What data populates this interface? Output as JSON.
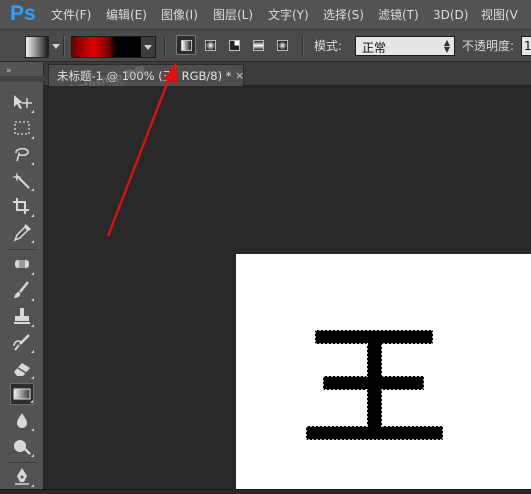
{
  "app": {
    "logo_text": "Ps",
    "brand_color": "#2fa0ff"
  },
  "menu": {
    "items": [
      {
        "label": "文件(F)"
      },
      {
        "label": "编辑(E)"
      },
      {
        "label": "图像(I)"
      },
      {
        "label": "图层(L)"
      },
      {
        "label": "文字(Y)"
      },
      {
        "label": "选择(S)"
      },
      {
        "label": "滤镜(T)"
      },
      {
        "label": "3D(D)"
      },
      {
        "label": "视图(V"
      }
    ]
  },
  "options_bar": {
    "gradient_colors": [
      "#6a0000",
      "#e00000",
      "#000000"
    ],
    "gradient_types": [
      "linear",
      "radial",
      "angle",
      "reflected",
      "diamond"
    ],
    "active_gradient_type": "linear",
    "mode_label": "模式:",
    "mode_value": "正常",
    "opacity_label": "不透明度:",
    "opacity_value": "1"
  },
  "toolbox": {
    "tools": [
      {
        "name": "move-tool",
        "glyph": "▸✥"
      },
      {
        "name": "marquee-tool",
        "glyph": "⬚"
      },
      {
        "name": "lasso-tool",
        "glyph": "ℓ"
      },
      {
        "name": "magic-wand-tool",
        "glyph": "✵"
      },
      {
        "name": "crop-tool",
        "glyph": "⊞"
      },
      {
        "name": "eyedropper-tool",
        "glyph": "✎"
      },
      {
        "name": "healing-brush-tool",
        "glyph": "✺"
      },
      {
        "name": "brush-tool",
        "glyph": "✒"
      },
      {
        "name": "clone-stamp-tool",
        "glyph": "⊥"
      },
      {
        "name": "history-brush-tool",
        "glyph": "⟲"
      },
      {
        "name": "eraser-tool",
        "glyph": "◩"
      },
      {
        "name": "gradient-tool",
        "glyph": "▬"
      },
      {
        "name": "blur-tool",
        "glyph": "💧"
      },
      {
        "name": "dodge-tool",
        "glyph": "◉"
      },
      {
        "name": "pen-tool",
        "glyph": "✑"
      }
    ],
    "active_tool": "gradient-tool"
  },
  "document": {
    "tab_title": "未标题-1 @ 100% (王, RGB/8) *",
    "close_glyph": "×",
    "canvas_text": "王",
    "watermark_line1": "Photoshop 教程",
    "watermark_line2": "bbs.16xx8.com"
  },
  "annotation": {
    "arrow_color": "#e01010"
  }
}
